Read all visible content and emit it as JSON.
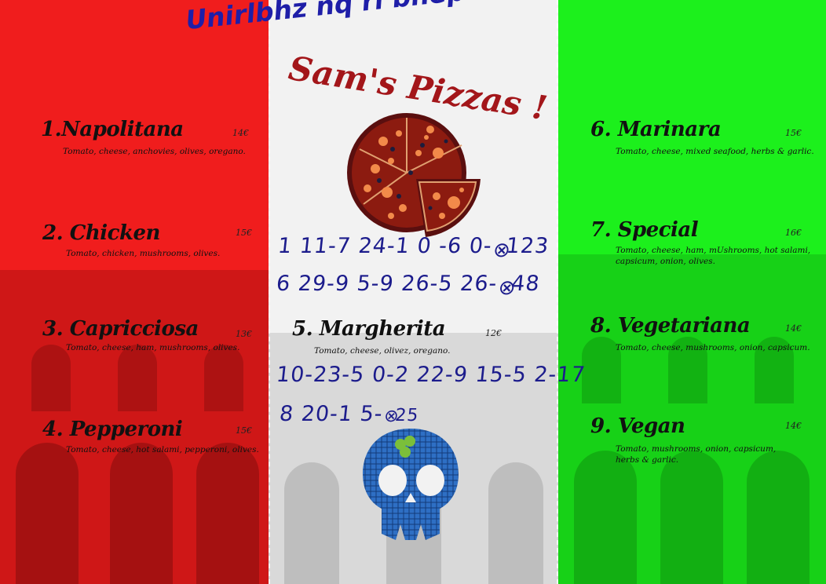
{
  "header": {
    "cipher_text": "Unirlbhz nq rl bhepubvp r?",
    "title": "Sam's Pizzas !"
  },
  "codes": {
    "line1": "1 11-7 24-1 0 -6 0-",
    "line1_end": "123",
    "line2": "6 29-9 5-9 26-5 26-",
    "line2_end": "48",
    "line3": "10-23-5 0-2 22-9 15-5 2-17",
    "line4": "8 20-1 5-",
    "line4_end": "25"
  },
  "menu": {
    "left": [
      {
        "name": "1.Napolitana",
        "price": "14€",
        "desc": "Tomato, cheese, anchovies, olives, oregano."
      },
      {
        "name": "2. Chicken",
        "price": "15€",
        "desc": "Tomato, chicken, mushrooms, olives."
      },
      {
        "name": "3. Capricciosa",
        "price": "13€",
        "desc": "Tomato, cheese, ham, mushrooms, olives."
      },
      {
        "name": "4. Pepperoni",
        "price": "15€",
        "desc": "Tomato, cheese, hot salami, pepperoni, olives."
      }
    ],
    "center": [
      {
        "name": "5. Margherita",
        "price": "12€",
        "desc": "Tomato, cheese, olivez, oregano."
      }
    ],
    "right": [
      {
        "name": "6. Marinara",
        "price": "15€",
        "desc": "Tomato, cheese, mixed seafood, herbs & garlic."
      },
      {
        "name": "7. Special",
        "price": "16€",
        "desc_1": "Tomato, cheese, ham, mUshrooms, hot salami,",
        "desc_2": "capsicum, onion, olives."
      },
      {
        "name": "8. Vegetariana",
        "price": "14€",
        "desc": "Tomato, cheese, mushrooms, onion, capsicum."
      },
      {
        "name": "9. Vegan",
        "price": "14€",
        "desc_1": "Tomato, mushrooms, onion, capsicum,",
        "desc_2": "herbs & garlic."
      }
    ]
  },
  "colors": {
    "red_panel": "#f01d1d",
    "white_panel": "#f2f2f2",
    "green_panel": "#1cf01c",
    "title_color": "#a3161a",
    "handwriting": "#1c1c8c"
  },
  "icons": [
    "pizza-icon",
    "skull-icon"
  ]
}
